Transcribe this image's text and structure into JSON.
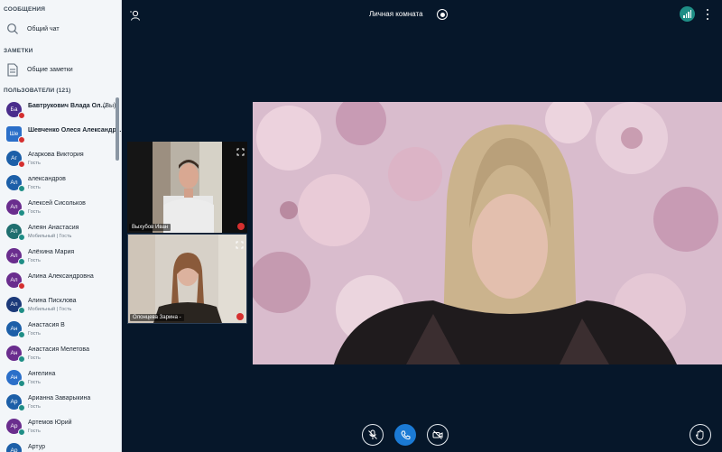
{
  "sidebar": {
    "messages_title": "СООБЩЕНИЯ",
    "public_chat": "Общий чат",
    "notes_title": "ЗАМЕТКИ",
    "shared_notes": "Общие заметки",
    "users_title": "ПОЛЬЗОВАТЕЛИ (121)",
    "users": [
      {
        "initials": "Ба",
        "name": "Бавтрукович Влада Ол...",
        "role": "",
        "you": "(Вы)",
        "avatar_color": "#4a2d8c",
        "mic_color": "#d52f2f",
        "square": false,
        "bold": true
      },
      {
        "initials": "Ше",
        "name": "Шевченко Олеся Александр...",
        "role": "",
        "you": "",
        "avatar_color": "#2b6fc9",
        "mic_color": "#d52f2f",
        "square": true,
        "bold": true
      },
      {
        "initials": "Аг",
        "name": "Агаркова Виктория",
        "role": "Гость",
        "you": "",
        "avatar_color": "#1c5fa8",
        "mic_color": "#d52f2f",
        "square": false,
        "bold": false
      },
      {
        "initials": "Ал",
        "name": "александров",
        "role": "Гость",
        "you": "",
        "avatar_color": "#1c5fa8",
        "mic_color": "#1f8e86",
        "square": false,
        "bold": false
      },
      {
        "initials": "Ал",
        "name": "Алексей Сисольков",
        "role": "Гость",
        "you": "",
        "avatar_color": "#6a2d8e",
        "mic_color": "#1f8e86",
        "square": false,
        "bold": false
      },
      {
        "initials": "Ал",
        "name": "Алеян Анастасия",
        "role": "Мобильный | Гость",
        "you": "",
        "avatar_color": "#1f6f6f",
        "mic_color": "#1f8e86",
        "square": false,
        "bold": false
      },
      {
        "initials": "Ал",
        "name": "Алёхина Мария",
        "role": "Гость",
        "you": "",
        "avatar_color": "#6a2d8e",
        "mic_color": "#1f8e86",
        "square": false,
        "bold": false
      },
      {
        "initials": "Ал",
        "name": "Алина Александровна",
        "role": "",
        "you": "",
        "avatar_color": "#6a2d8e",
        "mic_color": "#d52f2f",
        "square": false,
        "bold": false
      },
      {
        "initials": "Ал",
        "name": "Алина Писклова",
        "role": "Мобильный | Гость",
        "you": "",
        "avatar_color": "#1c3a7a",
        "mic_color": "#1f8e86",
        "square": false,
        "bold": false
      },
      {
        "initials": "Ан",
        "name": "Анастасия В",
        "role": "Гость",
        "you": "",
        "avatar_color": "#1c5fa8",
        "mic_color": "#1f8e86",
        "square": false,
        "bold": false
      },
      {
        "initials": "Ан",
        "name": "Анастасия Мелетова",
        "role": "Гость",
        "you": "",
        "avatar_color": "#6a2d8e",
        "mic_color": "#1f8e86",
        "square": false,
        "bold": false
      },
      {
        "initials": "Ан",
        "name": "Ангелина",
        "role": "Гость",
        "you": "",
        "avatar_color": "#2b6fc9",
        "mic_color": "#1f8e86",
        "square": false,
        "bold": false
      },
      {
        "initials": "Ар",
        "name": "Арианна Заварыкина",
        "role": "Гость",
        "you": "",
        "avatar_color": "#1c5fa8",
        "mic_color": "#1f8e86",
        "square": false,
        "bold": false
      },
      {
        "initials": "Ар",
        "name": "Артемов Юрий",
        "role": "Гость",
        "you": "",
        "avatar_color": "#6a2d8e",
        "mic_color": "#1f8e86",
        "square": false,
        "bold": false
      },
      {
        "initials": "Ар",
        "name": "Артур",
        "role": "",
        "you": "",
        "avatar_color": "#1c5fa8",
        "mic_color": "#1f8e86",
        "square": false,
        "bold": false
      }
    ]
  },
  "topbar": {
    "room_title": "Личная комната"
  },
  "videos": {
    "tile1_name": "Выхубов Иван",
    "tile2_name": "Олонцева Зарина -"
  },
  "icons": {
    "chat": "search-chat-icon",
    "notes": "document-icon",
    "users": "user-icon",
    "record": "record-icon",
    "connection": "signal-icon",
    "more": "more-vertical-icon",
    "expand": "expand-icon",
    "mic_off": "mic-off-icon",
    "phone": "phone-icon",
    "camera_off": "camera-off-icon",
    "raise_hand": "hand-icon"
  },
  "colors": {
    "background": "#06172a",
    "sidebar": "#f3f6f9",
    "primary": "#1b7ad4",
    "connection": "#1f8e86",
    "muted": "#d52f2f"
  }
}
